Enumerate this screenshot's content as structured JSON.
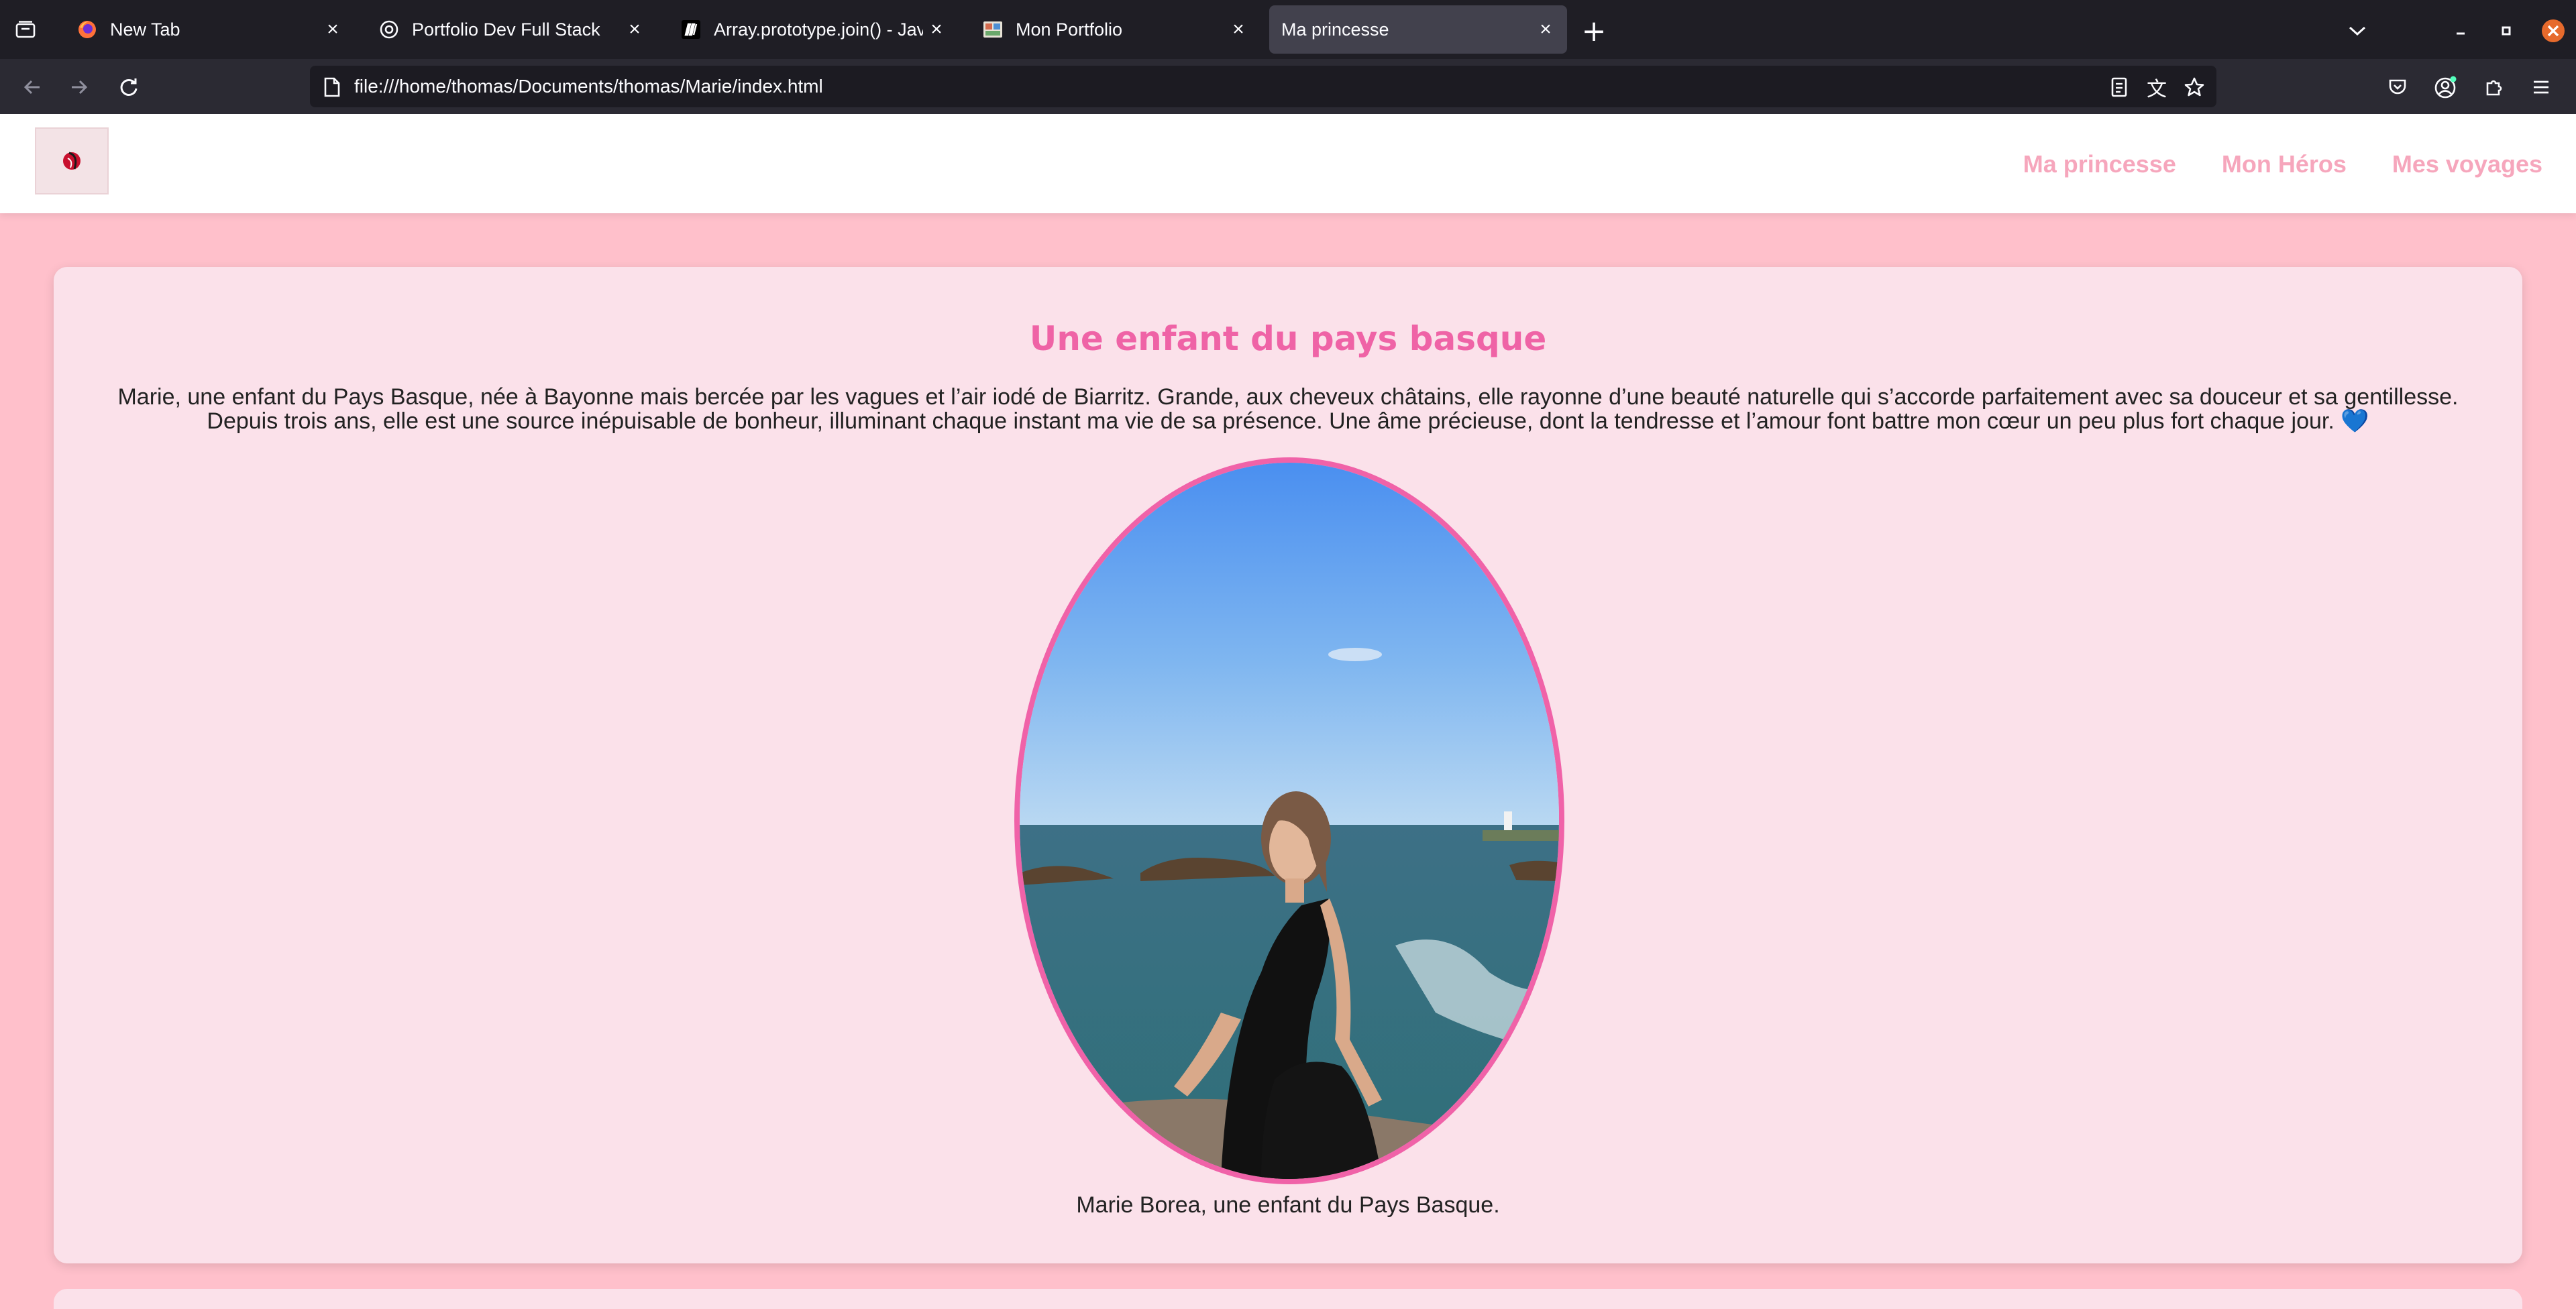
{
  "browser": {
    "tabs": [
      {
        "title": "New Tab",
        "favicon": "firefox-icon",
        "active": false
      },
      {
        "title": "Portfolio Dev Full Stack",
        "favicon": "globe-icon",
        "active": false
      },
      {
        "title": "Array.prototype.join() - JavaScript | MDN",
        "favicon": "mdn-icon",
        "active": false
      },
      {
        "title": "Mon Portfolio",
        "favicon": "portfolio-icon",
        "active": false
      },
      {
        "title": "Ma princesse",
        "favicon": "",
        "active": true
      }
    ],
    "url": "file:///home/thomas/Documents/thomas/Marie/index.html",
    "colors": {
      "tabstrip": "#1f1e25",
      "toolbar": "#2b2a33",
      "urlbar": "#1c1b22",
      "close_button": "#e66a2c"
    }
  },
  "site": {
    "nav": [
      "Ma princesse",
      "Mon Héros",
      "Mes voyages"
    ],
    "section": {
      "title": "Une enfant du pays basque",
      "text": "Marie, une enfant du Pays Basque, née à Bayonne mais bercée par les vagues et l’air iodé de Biarritz. Grande, aux cheveux châtains, elle rayonne d’une beauté naturelle qui s’accorde parfaitement avec sa douceur et sa gentillesse. Depuis trois ans, elle est une source inépuisable de bonheur, illuminant chaque instant ma vie de sa présence. Une âme précieuse, dont la tendresse et l’amour font battre mon cœur un peu plus fort chaque jour.",
      "emoji": "💙",
      "caption": "Marie Borea, une enfant du Pays Basque."
    },
    "colors": {
      "background": "#ffc0cb",
      "card": "#fbe1ea",
      "title": "#ef63a6",
      "nav_link": "#f6a6bc",
      "photo_border": "#f062a8"
    }
  }
}
